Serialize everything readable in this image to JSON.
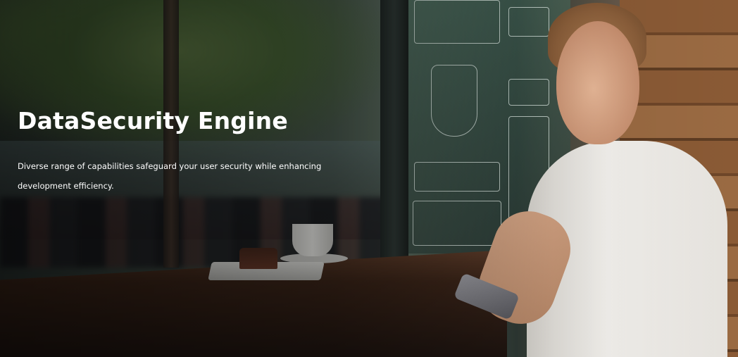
{
  "hero": {
    "title": "DataSecurity Engine",
    "subtitle": "Diverse range of capabilities safeguard your user security while enhancing development efficiency."
  },
  "colors": {
    "text": "#ffffff",
    "overlay": "#000000"
  }
}
